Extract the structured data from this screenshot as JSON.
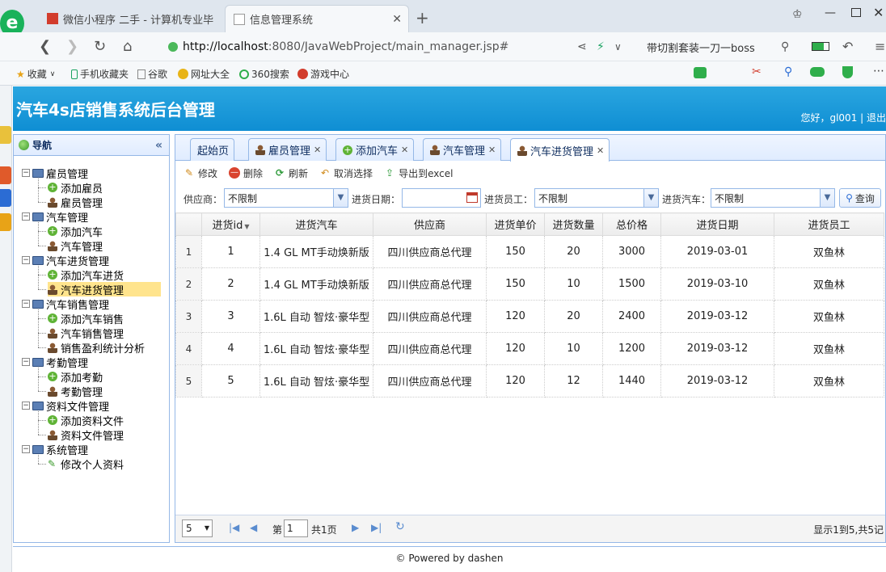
{
  "browser": {
    "tabs": [
      {
        "label": "微信小程序 二手 - 计算机专业毕"
      },
      {
        "label": "信息管理系统"
      }
    ],
    "url_host": "http://localhost",
    "url_rest": ":8080/JavaWebProject/main_manager.jsp#",
    "search_hint": "带切割套装一刀一boss",
    "bookmarks": [
      "收藏",
      "手机收藏夹",
      "谷歌",
      "网址大全",
      "360搜索",
      "游戏中心"
    ]
  },
  "app": {
    "title": "汽车4s店销售系统后台管理",
    "greeting": "您好，gl001 | 退出"
  },
  "nav": {
    "title": "导航",
    "groups": [
      {
        "label": "雇员管理",
        "items": [
          "添加雇员",
          "雇员管理"
        ]
      },
      {
        "label": "汽车管理",
        "items": [
          "添加汽车",
          "汽车管理"
        ]
      },
      {
        "label": "汽车进货管理",
        "items": [
          "添加汽车进货",
          "汽车进货管理"
        ]
      },
      {
        "label": "汽车销售管理",
        "items": [
          "添加汽车销售",
          "汽车销售管理",
          "销售盈利统计分析"
        ]
      },
      {
        "label": "考勤管理",
        "items": [
          "添加考勤",
          "考勤管理"
        ]
      },
      {
        "label": "资料文件管理",
        "items": [
          "添加资料文件",
          "资料文件管理"
        ]
      },
      {
        "label": "系统管理",
        "items": [
          "修改个人资料"
        ]
      }
    ],
    "selected": "汽车进货管理"
  },
  "tabs": [
    "起始页",
    "雇员管理",
    "添加汽车",
    "汽车管理",
    "汽车进货管理"
  ],
  "toolbar": {
    "edit": "修改",
    "delete": "删除",
    "refresh": "刷新",
    "cancel_select": "取消选择",
    "export": "导出到excel"
  },
  "filters": {
    "supplier_label": "供应商：",
    "supplier_value": "不限制",
    "date_label": "进货日期：",
    "date_value": "",
    "employee_label": "进货员工：",
    "employee_value": "不限制",
    "car_label": "进货汽车：",
    "car_value": "不限制",
    "query": "查询"
  },
  "table": {
    "headers": [
      "进货id",
      "进货汽车",
      "供应商",
      "进货单价",
      "进货数量",
      "总价格",
      "进货日期",
      "进货员工"
    ],
    "rows": [
      [
        "1",
        "1",
        "1.4 GL MT手动焕新版",
        "四川供应商总代理",
        "150",
        "20",
        "3000",
        "2019-03-01",
        "双鱼林"
      ],
      [
        "2",
        "2",
        "1.4 GL MT手动焕新版",
        "四川供应商总代理",
        "150",
        "10",
        "1500",
        "2019-03-10",
        "双鱼林"
      ],
      [
        "3",
        "3",
        "1.6L 自动 智炫·豪华型",
        "四川供应商总代理",
        "120",
        "20",
        "2400",
        "2019-03-12",
        "双鱼林"
      ],
      [
        "4",
        "4",
        "1.6L 自动 智炫·豪华型",
        "四川供应商总代理",
        "120",
        "10",
        "1200",
        "2019-03-12",
        "双鱼林"
      ],
      [
        "5",
        "5",
        "1.6L 自动 智炫·豪华型",
        "四川供应商总代理",
        "120",
        "12",
        "1440",
        "2019-03-12",
        "双鱼林"
      ]
    ]
  },
  "pager": {
    "page_size": "5",
    "page_prefix": "第",
    "page_value": "1",
    "page_suffix": "共1页",
    "summary": "显示1到5,共5记"
  },
  "footer": "© Powered by dashen"
}
